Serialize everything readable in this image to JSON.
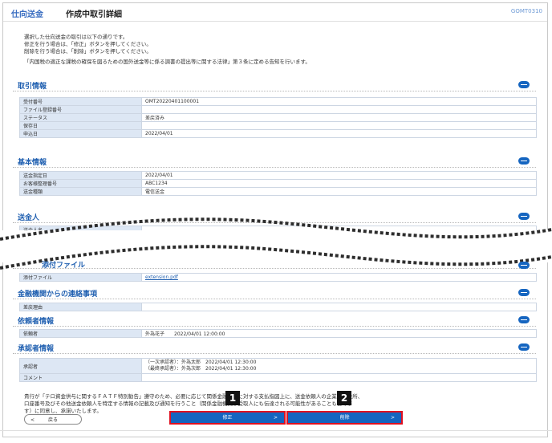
{
  "header": {
    "app_title": "仕向送金",
    "screen_title": "作成中取引詳細",
    "screen_id": "GOMT0310"
  },
  "intro_lines": [
    "選択した仕向送金の取引は以下の通りです。",
    "修正を行う場合は、「修正」ボタンを押してください。",
    "削除を行う場合は、「削除」ボタンを押してください。",
    "「内国税の適正な課税の確保を図るための国外送金等に係る調書の提出等に関する法律」第３条に定める告知を行います。"
  ],
  "sections": {
    "transaction": {
      "title": "取引情報",
      "rows": [
        {
          "label": "受付番号",
          "value": "OMT20220401100001"
        },
        {
          "label": "ファイル登録番号",
          "value": ""
        },
        {
          "label": "ステータス",
          "value": "差戻済み"
        },
        {
          "label": "保存日",
          "value": ""
        },
        {
          "label": "申込日",
          "value": "2022/04/01"
        }
      ]
    },
    "basic": {
      "title": "基本情報",
      "rows": [
        {
          "label": "送金指定日",
          "value": "2022/04/01"
        },
        {
          "label": "お客様整理番号",
          "value": "ABC1234"
        },
        {
          "label": "送金種類",
          "value": "電信送金"
        }
      ]
    },
    "remitter": {
      "title": "送金人",
      "rows": [
        {
          "label": "送金人名",
          "value": ""
        }
      ]
    },
    "file": {
      "title": "添付ファイル",
      "rows": [
        {
          "label": "添付ファイル",
          "value": "extension.pdf"
        }
      ]
    },
    "bank_notice": {
      "title": "金融機関からの連絡事項",
      "rows": [
        {
          "label": "差戻理由",
          "value": ""
        }
      ]
    },
    "requester": {
      "title": "依頼者情報",
      "rows": [
        {
          "label": "依頼者",
          "value": "外為花子　　2022/04/01 12:00:00"
        }
      ]
    },
    "approver": {
      "title": "承認者情報",
      "rows": [
        {
          "label": "承認者",
          "value": "（一次承認者）：外為太郎　2022/04/01 12:30:00",
          "value2": "（最終承認者）：外為次郎　2022/04/01 12:30:00"
        },
        {
          "label": "コメント",
          "value": ""
        }
      ]
    }
  },
  "footnote_lines": [
    "貴行が「テロ資金供与に関するＦＡＴＦ特別勧告」遵守のため、必要に応じて関係金融機関に対する支払指図上に、送金依頼人の企業名、住所、",
    "口座番号及びその他送金依頼人を特定する情報の記載及び通知を行うこと（関係金融機関が受取人にも伝達される可能性があることも含みま",
    "す）に同意し、承諾いたします。"
  ],
  "buttons": {
    "back": "戻る",
    "modify": "修正",
    "delete": "削除"
  },
  "callouts": {
    "one": "1",
    "two": "2"
  },
  "colors": {
    "accent": "#1565c0",
    "highlight": "#e01020",
    "label_bg": "#dde7f4"
  }
}
